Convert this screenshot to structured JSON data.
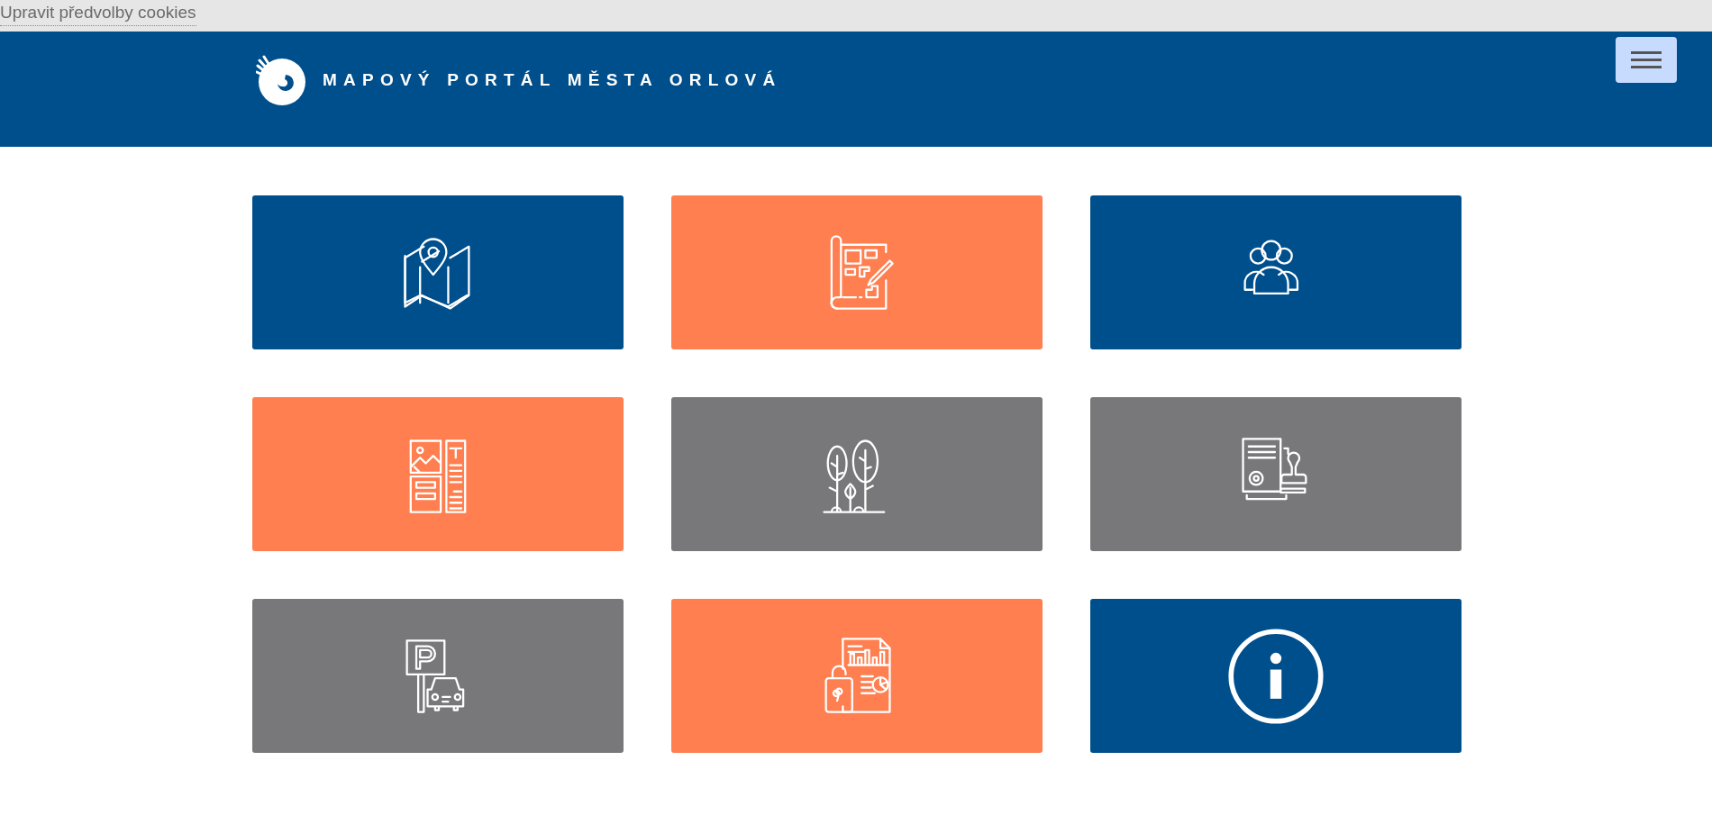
{
  "cookie_bar": {
    "link": "Upravit předvolby cookies"
  },
  "header": {
    "title": "MAPOVÝ PORTÁL MĚSTA ORLOVÁ"
  },
  "tiles": [
    {
      "kind": "map",
      "color": "#004f8d"
    },
    {
      "kind": "plan",
      "color": "#ff7f50"
    },
    {
      "kind": "people",
      "color": "#004f8d"
    },
    {
      "kind": "layout",
      "color": "#ff7f50"
    },
    {
      "kind": "trees",
      "color": "#78787a"
    },
    {
      "kind": "stamp",
      "color": "#78787a"
    },
    {
      "kind": "parking",
      "color": "#78787a"
    },
    {
      "kind": "report",
      "color": "#ff7f50"
    },
    {
      "kind": "info",
      "color": "#004f8d"
    }
  ]
}
